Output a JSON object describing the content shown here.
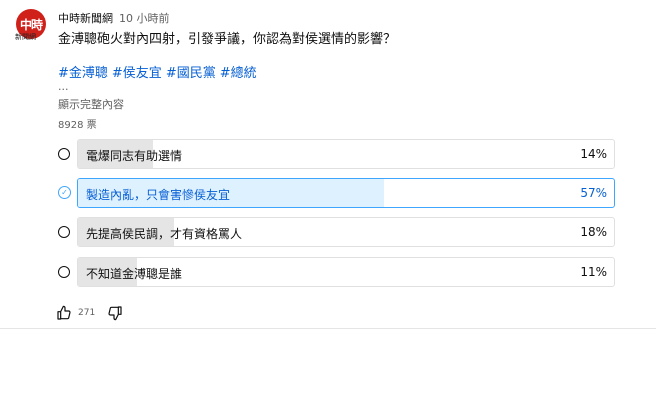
{
  "channel": {
    "avatar_text": "中時",
    "avatar_subtext": "新聞網",
    "name": "中時新聞網",
    "time": "10 小時前"
  },
  "post": {
    "question": "金溥聰砲火對內四射，引發爭議，你認為對侯選情的影響？",
    "tags": [
      "#金溥聰",
      "#侯友宜",
      "#國民黨",
      "#總統"
    ],
    "ellipsis": "...",
    "show_more": "顯示完整內容",
    "votes": "8928 票"
  },
  "poll": {
    "options": [
      {
        "label": "電爆同志有助選情",
        "percent": "14%",
        "fraction": 0.14,
        "selected": false
      },
      {
        "label": "製造內亂，只會害慘侯友宜",
        "percent": "57%",
        "fraction": 0.57,
        "selected": true
      },
      {
        "label": "先提高侯民調，才有資格罵人",
        "percent": "18%",
        "fraction": 0.18,
        "selected": false
      },
      {
        "label": "不知道金溥聰是誰",
        "percent": "11%",
        "fraction": 0.11,
        "selected": false
      }
    ]
  },
  "actions": {
    "like_count": "271"
  },
  "colors": {
    "brand": "#d0201a",
    "link": "#065fd4",
    "selected_border": "#3ea6ff",
    "selected_fill": "#def1ff",
    "bar_fill": "#e5e5e5"
  }
}
